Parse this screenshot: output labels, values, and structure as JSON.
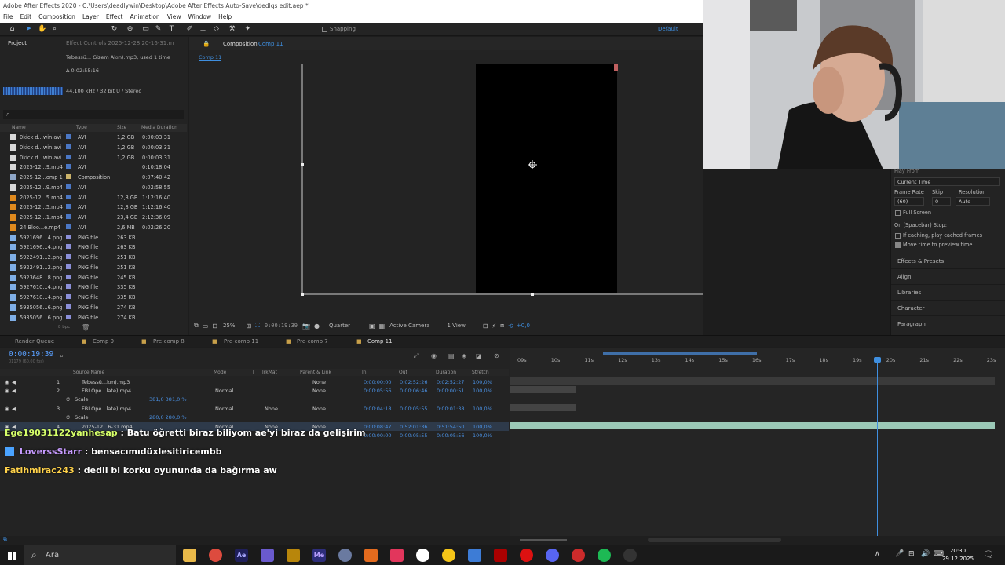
{
  "window": {
    "title": "Adobe After Effects 2020 - C:\\Users\\deadlywin\\Desktop\\Adobe After Effects Auto-Save\\dedlqs edit.aep *"
  },
  "menu": [
    "File",
    "Edit",
    "Composition",
    "Layer",
    "Effect",
    "Animation",
    "View",
    "Window",
    "Help"
  ],
  "toolbar": {
    "snapping_label": "Snapping",
    "workspace": "Default"
  },
  "project": {
    "tab_label": "Project",
    "effect_controls_tab": "Effect Controls 2025-12-28 20-16-31.m",
    "selected_item": "Tebessü... Gizem Akın).mp3",
    "used_info": ", used 1 time",
    "duration": "Δ 0:02:55:16",
    "audio_meta": "44,100 kHz / 32 bit U / Stereo",
    "search_icon": "search-icon",
    "columns": [
      "Name",
      "Type",
      "Size",
      "Media Duration"
    ],
    "items": [
      {
        "name": "0kick d...win.avi",
        "type": "AVI",
        "size": "1,2 GB",
        "duration": "0:00:03:31",
        "icon": "video-file-icon"
      },
      {
        "name": "0kick d...win.avi",
        "type": "AVI",
        "size": "1,2 GB",
        "duration": "0:00:03:31",
        "icon": "video-file-icon"
      },
      {
        "name": "0kick d...win.avi",
        "type": "AVI",
        "size": "1,2 GB",
        "duration": "0:00:03:31",
        "icon": "video-file-icon"
      },
      {
        "name": "2025-12...9.mp4",
        "type": "AVI",
        "size": "",
        "duration": "0:10:18:04",
        "icon": "video-file-icon"
      },
      {
        "name": "2025-12...omp 1",
        "type": "Composition",
        "size": "",
        "duration": "0:07:40:42",
        "icon": "composition-icon"
      },
      {
        "name": "2025-12...9.mp4",
        "type": "AVI",
        "size": "",
        "duration": "0:02:58:55",
        "icon": "video-file-icon"
      },
      {
        "name": "2025-12...5.mp4",
        "type": "AVI",
        "size": "12,8 GB",
        "duration": "1:12:16:40",
        "icon": "warning-file-icon"
      },
      {
        "name": "2025-12...5.mp4",
        "type": "AVI",
        "size": "12,8 GB",
        "duration": "1:12:16:40",
        "icon": "warning-file-icon"
      },
      {
        "name": "2025-12...1.mp4",
        "type": "AVI",
        "size": "23,4 GB",
        "duration": "2:12:36:09",
        "icon": "warning-file-icon"
      },
      {
        "name": "24 Bloo...e.mp4",
        "type": "AVI",
        "size": "2,6 MB",
        "duration": "0:02:26:20",
        "icon": "warning-file-icon"
      },
      {
        "name": "5921696...4.png",
        "type": "PNG file",
        "size": "263 KB",
        "duration": "",
        "icon": "image-file-icon"
      },
      {
        "name": "5921696...4.png",
        "type": "PNG file",
        "size": "263 KB",
        "duration": "",
        "icon": "image-file-icon"
      },
      {
        "name": "5922491...2.png",
        "type": "PNG file",
        "size": "251 KB",
        "duration": "",
        "icon": "image-file-icon"
      },
      {
        "name": "5922491...2.png",
        "type": "PNG file",
        "size": "251 KB",
        "duration": "",
        "icon": "image-file-icon"
      },
      {
        "name": "5923648...8.png",
        "type": "PNG file",
        "size": "245 KB",
        "duration": "",
        "icon": "image-file-icon"
      },
      {
        "name": "5927610...4.png",
        "type": "PNG file",
        "size": "335 KB",
        "duration": "",
        "icon": "image-file-icon"
      },
      {
        "name": "5927610...4.png",
        "type": "PNG file",
        "size": "335 KB",
        "duration": "",
        "icon": "image-file-icon"
      },
      {
        "name": "5935056...6.png",
        "type": "PNG file",
        "size": "274 KB",
        "duration": "",
        "icon": "image-file-icon"
      },
      {
        "name": "5935056...6.png",
        "type": "PNG file",
        "size": "274 KB",
        "duration": "",
        "icon": "image-file-icon"
      }
    ],
    "footer_bpc": "8 bpc"
  },
  "composition": {
    "tab_prefix": "Composition",
    "tab_name": "Comp 11",
    "sub_tab": "Comp 11",
    "zoom": "25%",
    "timecode": "0:00:19:39",
    "resolution": "Quarter",
    "camera": "Active Camera",
    "views": "1 View",
    "exposure": "+0,0"
  },
  "preview": {
    "play_from": "Play From",
    "play_from_value": "Current Time",
    "frame_rate_label": "Frame Rate",
    "skip_label": "Skip",
    "resolution_label": "Resolution",
    "frame_rate_value": "(60)",
    "skip_value": "0",
    "resolution_value": "Auto",
    "full_screen": "Full Screen",
    "on_stop": "On (Spacebar) Stop:",
    "cache_option": "If caching, play cached frames",
    "move_time": "Move time to preview time",
    "sections": [
      "Effects & Presets",
      "Align",
      "Libraries",
      "Character",
      "Paragraph"
    ]
  },
  "timeline": {
    "tabs": [
      "Render Queue",
      "Comp 9",
      "Pre-comp 8",
      "Pre-comp 11",
      "Pre-comp 7",
      "Comp 11"
    ],
    "current_time": "0:00:19:39",
    "fps_note": "01179 (60.00 fps)",
    "columns": [
      "Source Name",
      "Mode",
      "T",
      "TrkMat",
      "Parent & Link",
      "In",
      "Out",
      "Duration",
      "Stretch"
    ],
    "ruler": [
      "09s",
      "10s",
      "11s",
      "12s",
      "13s",
      "14s",
      "15s",
      "16s",
      "17s",
      "18s",
      "19s",
      "20s",
      "21s",
      "22s",
      "23s"
    ],
    "layers": [
      {
        "num": "1",
        "name": "Tebessü...km).mp3",
        "mode": "",
        "trkmat": "",
        "parent": "None",
        "in": "0:00:00:00",
        "out": "0:02:52:26",
        "duration": "0:02:52:27",
        "stretch": "100,0%"
      },
      {
        "num": "2",
        "name": "FBI Ope...late).mp4",
        "mode": "Normal",
        "trkmat": "",
        "parent": "None",
        "in": "0:00:05:56",
        "out": "0:00:06:46",
        "duration": "0:00:00:51",
        "stretch": "100,0%"
      },
      {
        "num": "3",
        "name": "FBI Ope...late).mp4",
        "mode": "Normal",
        "trkmat": "None",
        "parent": "None",
        "in": "0:00:04:18",
        "out": "0:00:05:55",
        "duration": "0:00:01:38",
        "stretch": "100,0%"
      },
      {
        "num": "4",
        "name": "2025-12...6-31.mp4",
        "mode": "Normal",
        "trkmat": "None",
        "parent": "None",
        "in": "0:00:08:47",
        "out": "0:52:01:36",
        "duration": "0:51:54:50",
        "stretch": "100,0%"
      }
    ],
    "scale_label": "Scale",
    "scale_values": [
      "381,0 381,0 %",
      "280,0 280,0 %"
    ],
    "extra_row": {
      "in": "0:00:00:00",
      "out": "0:00:05:55",
      "duration": "0:00:05:56",
      "stretch": "100,0%"
    }
  },
  "chat": [
    {
      "user": "Ege19031122yanhesap",
      "message": ": Batu öğretti biraz biliyom ae'yi biraz da gelişirim"
    },
    {
      "user": "LoverssStarr",
      "message": ": bensacımıdüxlesitiricembb"
    },
    {
      "user": "Fatihmirac243",
      "message": ": dedli bi korku oyununda da bağırma aw"
    }
  ],
  "taskbar": {
    "search_placeholder": "Ara",
    "time": "20:30",
    "date": "29.12.2025"
  }
}
